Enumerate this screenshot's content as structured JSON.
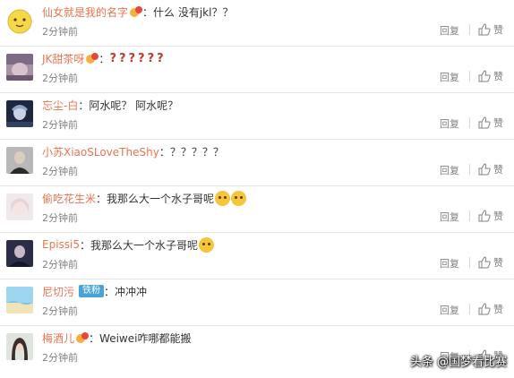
{
  "comments": [
    {
      "user": "仙女就是我的名字",
      "badge": true,
      "tag": "",
      "sep": "：",
      "text": "什么 没有jkl？？",
      "extra": "",
      "emojis": 0,
      "time": "2分钟前"
    },
    {
      "user": "JK甜茶呀",
      "badge": true,
      "tag": "",
      "sep": "：",
      "text": "",
      "extra": "??????",
      "emojis": 0,
      "time": "2分钟前"
    },
    {
      "user": "忘尘-白",
      "badge": false,
      "tag": "",
      "sep": "：",
      "text": "阿水呢？ 阿水呢？",
      "extra": "",
      "emojis": 0,
      "time": "2分钟前"
    },
    {
      "user": "小苏XiaoSLoveTheShy",
      "badge": false,
      "tag": "",
      "sep": "：",
      "text": "？？？？？",
      "extra": "",
      "emojis": 0,
      "time": "2分钟前"
    },
    {
      "user": "偷吃花生米",
      "badge": false,
      "tag": "",
      "sep": "：",
      "text": "我那么大一个水子哥呢",
      "extra": "",
      "emojis": 2,
      "time": "2分钟前"
    },
    {
      "user": "Epissi5",
      "badge": false,
      "tag": "",
      "sep": "：",
      "text": "我那么大一个水子哥呢",
      "extra": "",
      "emojis": 1,
      "time": "2分钟前"
    },
    {
      "user": "尼切污",
      "badge": false,
      "tag": "铁粉",
      "sep": "：",
      "text": "冲冲冲",
      "extra": "",
      "emojis": 0,
      "time": "2分钟前"
    },
    {
      "user": "梅酒儿",
      "badge": true,
      "tag": "",
      "sep": "：",
      "text": "Weiwei咋哪都能搬",
      "extra": "",
      "emojis": 0,
      "time": "2分钟前"
    }
  ],
  "reply_label": "回复",
  "like_label": "赞",
  "watermark": "头条 @国梦看比赛",
  "colors": {
    "username": "#eb7350",
    "text": "#333333",
    "meta": "#808080"
  }
}
